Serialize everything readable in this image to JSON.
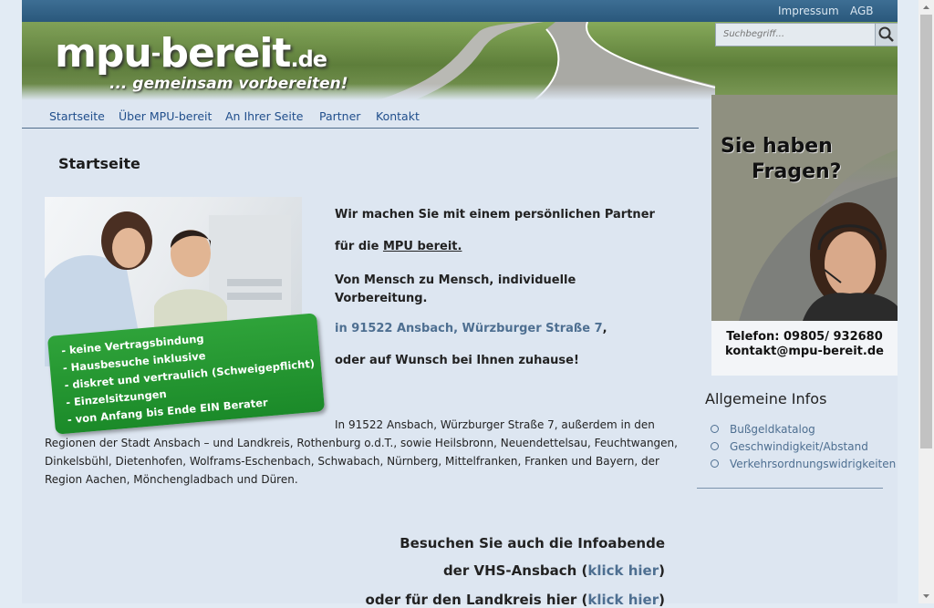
{
  "topbar": {
    "impressum": "Impressum",
    "agb": "AGB"
  },
  "header": {
    "logo_main": "mpu",
    "logo_dash": "-",
    "logo_main2": "bereit",
    "logo_tld": ".de",
    "logo_sub": "... gemeinsam vorbereiten!"
  },
  "search": {
    "placeholder": "Suchbegriff...",
    "icon": "search-icon"
  },
  "nav": [
    "Startseite",
    "Über MPU-bereit",
    "An Ihrer Seite",
    "Partner",
    "Kontakt"
  ],
  "sidebar": {
    "title_line1": "Sie haben",
    "title_line2": "Fragen?",
    "phone": "Telefon: 09805/ 932680",
    "email": "kontakt@mpu-bereit.de",
    "info_heading": "Allgemeine Infos",
    "info_items": [
      "Bußgeldkatalog",
      "Geschwindigkeit/Abstand",
      "Verkehrsordnungswidrigkeiten"
    ]
  },
  "main": {
    "heading": "Startseite",
    "benefits": [
      "-  keine Vertragsbindung",
      "-  Hausbesuche inklusive",
      "-  diskret und vertraulich (Schweigepflicht)",
      "-  Einzelsitzungen",
      "-  von Anfang bis Ende EIN Berater"
    ],
    "intro1": "Wir machen Sie mit einem persönlichen Partner",
    "intro2_pre": "für die ",
    "intro2_link": "MPU bereit.",
    "intro3": "Von Mensch zu Mensch, individuelle Vorbereitung.",
    "intro4_addr": "in 91522 Ansbach, Würzburger Straße 7",
    "intro4_post": ",",
    "intro5": "oder auf Wunsch bei Ihnen zuhause!",
    "body_line1": "In 91522 Ansbach, Würzburger Straße 7, außerdem in den",
    "body_rest": "Regionen der Stadt Ansbach – und Landkreis, Rothenburg o.d.T., sowie Heilsbronn, Neuendettelsau, Feuchtwangen, Dinkelsbühl, Dietenhofen, Wolframs-Eschenbach, Schwabach, Nürnberg, Mittelfranken, Franken und Bayern, der Region Aachen, Mönchengladbach und Düren.",
    "visit1": "Besuchen Sie auch die Infoabende",
    "visit2_pre": "der VHS-Ansbach (",
    "visit2_link": "klick hier",
    "visit2_post": ")",
    "visit3_pre": "oder für den Landkreis hier (",
    "visit3_link": "klick hier",
    "visit3_post": ")"
  }
}
